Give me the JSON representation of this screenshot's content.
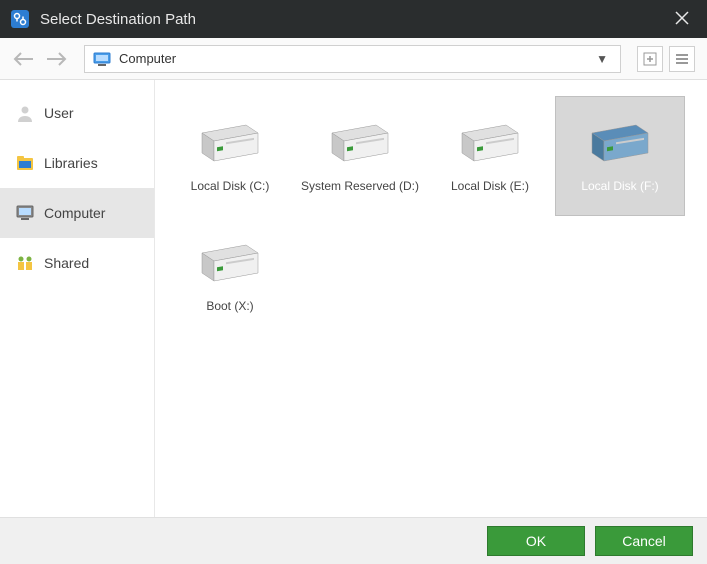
{
  "window": {
    "title": "Select Destination Path"
  },
  "path": {
    "current": "Computer"
  },
  "sidebar": {
    "items": [
      {
        "label": "User"
      },
      {
        "label": "Libraries"
      },
      {
        "label": "Computer"
      },
      {
        "label": "Shared"
      }
    ],
    "selected_index": 2
  },
  "disks": [
    {
      "label": "Local Disk (C:)"
    },
    {
      "label": "System Reserved (D:)"
    },
    {
      "label": "Local Disk (E:)"
    },
    {
      "label": "Local Disk (F:)"
    },
    {
      "label": "Boot (X:)"
    }
  ],
  "selected_disk_index": 3,
  "buttons": {
    "ok": "OK",
    "cancel": "Cancel"
  }
}
